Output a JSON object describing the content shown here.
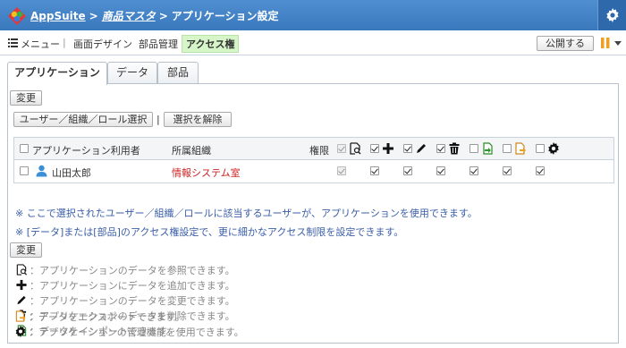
{
  "header": {
    "app": "AppSuite",
    "sep1": ">",
    "master": "商品マスタ",
    "sep2": ">",
    "page": "アプリケーション設定"
  },
  "toolbar": {
    "menu": "メニュー",
    "divider": "|",
    "design": "画面デザイン",
    "parts": "部品管理",
    "access": "アクセス権",
    "publish": "公開する"
  },
  "tabs": [
    "アプリケーション",
    "データ",
    "部品"
  ],
  "buttons": {
    "change1": "変更",
    "select": "ユーザー／組織／ロール選択",
    "sel_sep": "|",
    "clear": "選択を解除",
    "change2": "変更"
  },
  "table": {
    "headers": {
      "user": "アプリケーション利用者",
      "org": "所属組織",
      "perm": "権限"
    },
    "row": {
      "name": "山田太郎",
      "org": "情報システム室"
    }
  },
  "notes": [
    "※ ここで選択されたユーザー／組織／ロールに該当するユーザーが、アプリケーションを使用できます。",
    "※ [データ]または[部品]のアクセス権設定で、更に細かなアクセス制限を設定できます。"
  ],
  "legend": [
    {
      "icon": "view-icon",
      "text": "：アプリケーションのデータを参照できます。"
    },
    {
      "icon": "add-icon",
      "text": "：アプリケーションにデータを追加できます。"
    },
    {
      "icon": "edit-icon",
      "text": "：アプリケーションのデータを変更できます。"
    },
    {
      "icon": "delete-icon",
      "text": "：アプリケーションのデータを削除できます。"
    },
    {
      "icon": "import-icon",
      "text": "：データをインポートできます。"
    },
    {
      "icon": "export-icon",
      "text": "：データをエクスポートできます。"
    },
    {
      "icon": "admin-gear-icon",
      "text": "：アプリケーションの管理機能を使用できます。"
    }
  ],
  "colors": {
    "header": "#3a78bd",
    "active_tab_bg": "#d6f5c8",
    "org_link": "#cc2222",
    "note": "#3a5ea8"
  }
}
